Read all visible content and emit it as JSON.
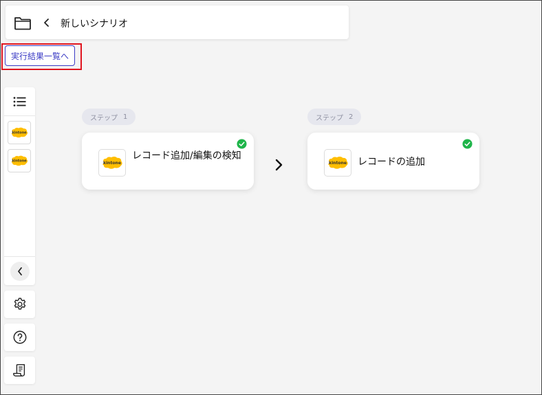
{
  "header": {
    "title": "新しいシナリオ",
    "folder_icon": "folder-icon",
    "back_icon": "chevron-left-icon"
  },
  "results_button": {
    "label": "実行結果一覧へ"
  },
  "sidebar": {
    "list_icon": "list-icon",
    "apps": [
      {
        "name": "kintone",
        "logo_text": "kintone"
      },
      {
        "name": "kintone",
        "logo_text": "kintone"
      }
    ],
    "collapse_icon": "chevron-left-icon",
    "settings_icon": "gear-icon",
    "help_icon": "help-icon",
    "log_icon": "scroll-icon"
  },
  "steps": [
    {
      "badge_label": "ステップ",
      "badge_number": "1",
      "logo_text": "kintone",
      "label": "レコード追加/編集の検知",
      "status": "complete"
    },
    {
      "badge_label": "ステップ",
      "badge_number": "2",
      "logo_text": "kintone",
      "label": "レコードの追加",
      "status": "complete"
    }
  ],
  "colors": {
    "accent": "#3b3bc5",
    "highlight": "#e0141e",
    "kintone_yellow": "#ffbe00",
    "check_green": "#1fb54a",
    "background": "#f4f4f4"
  }
}
